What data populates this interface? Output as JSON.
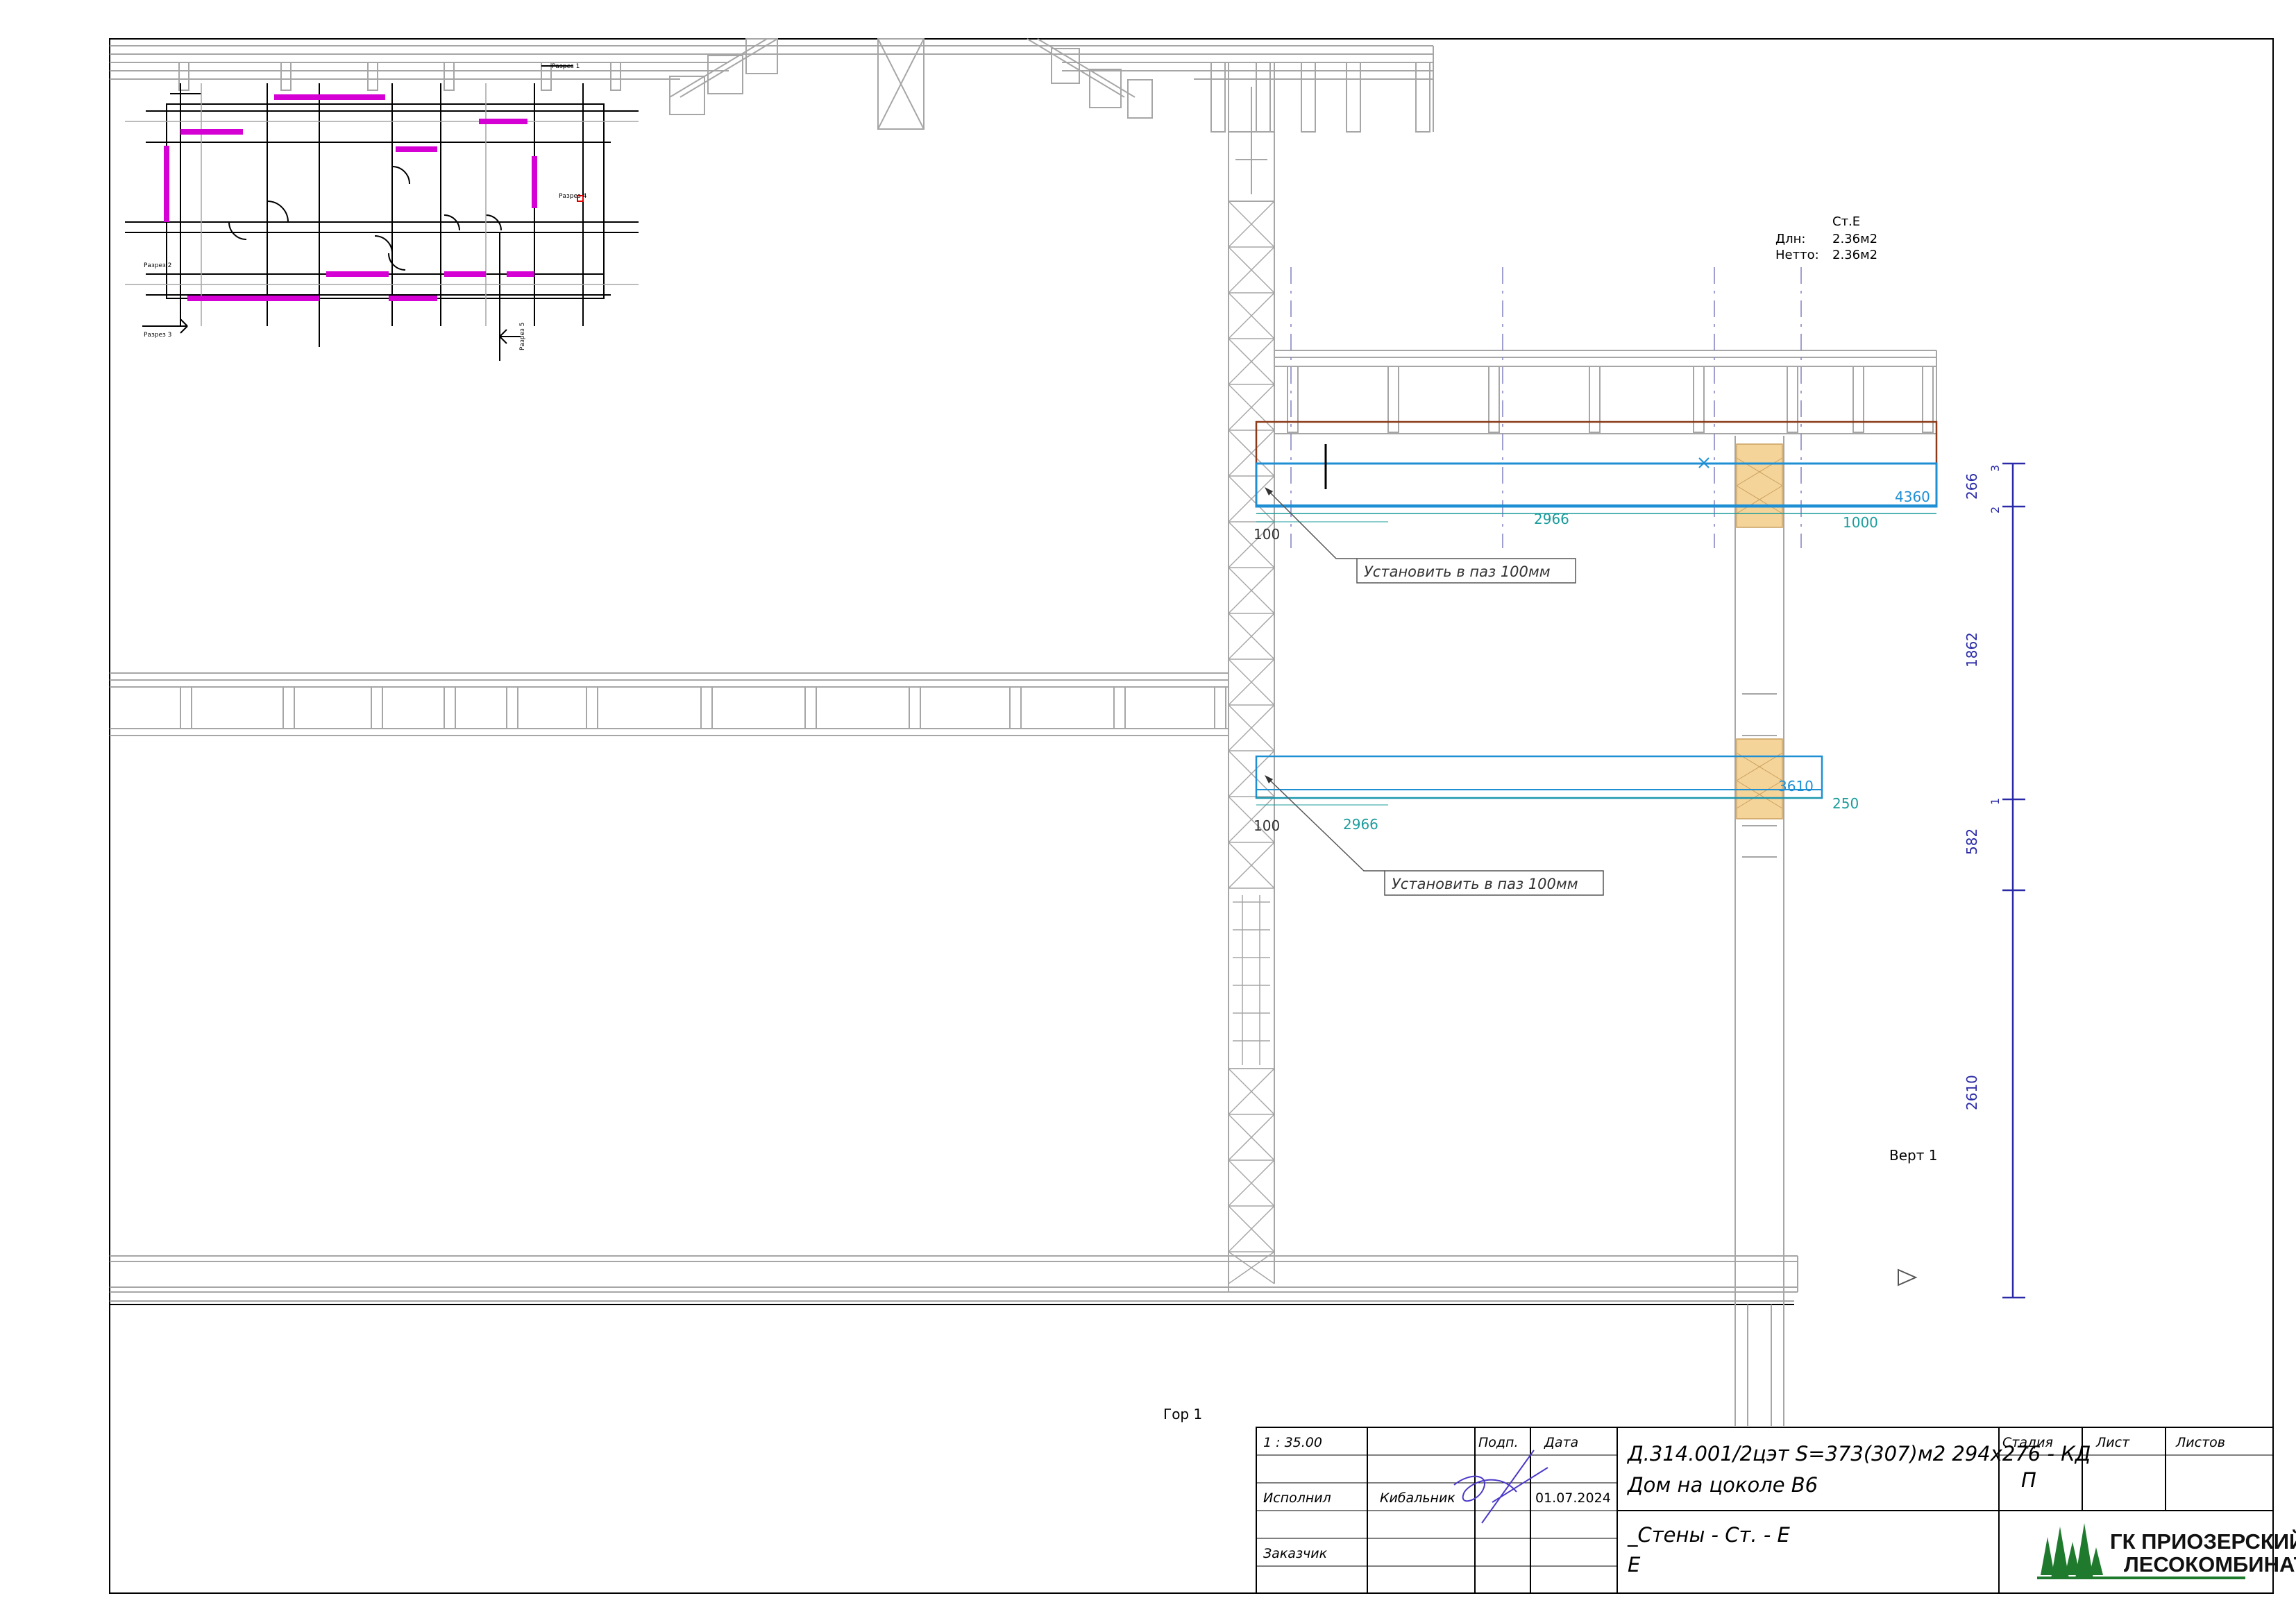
{
  "drawing": {
    "wall_label": "Ст.E",
    "dln_label": "Длн:",
    "dln_value": "2.36м2",
    "netto_label": "Нетто:",
    "netto_value": "2.36м2",
    "vert_label": "Верт 1",
    "hor_label": "Гор 1"
  },
  "beams": [
    {
      "length_label": "4360",
      "segment_label": "2966",
      "overhang_label": "1000",
      "offset_label": "100",
      "note": "Установить в паз 100мм"
    },
    {
      "length_label": "3610",
      "segment_label": "2966",
      "overhang_label": "250",
      "offset_label": "100",
      "note": "Установить в паз 100мм"
    }
  ],
  "vertical_dimensions": {
    "values": [
      "266",
      "1862",
      "582",
      "2610"
    ],
    "level_marks": [
      "3",
      "2",
      "1"
    ]
  },
  "plan": {
    "section_labels": [
      "Разрез 1",
      "Разрез 2",
      "Разрез 3",
      "Разрез 4",
      "Разрез 5"
    ]
  },
  "title_block": {
    "scale": "1 : 35.00",
    "sign_header": "Подп.",
    "date_header": "Дата",
    "role_executor": "Исполнил",
    "executor_name": "Кибальник",
    "date": "01.07.2024",
    "role_customer": "Заказчик",
    "project_code": "Д.314.001/2цэт S=373(307)м2 294х276 - КД",
    "project_name": "Дом на цоколе В6",
    "sheet_title": "_Стены - Ст. - E",
    "sheet_subtitle": "E",
    "stage_header": "Стадия",
    "stage_value": "П",
    "sheet_header": "Лист",
    "sheets_header": "Листов",
    "company_line1": "ГК ПРИОЗЕРСКИЙ",
    "company_line2": "ЛЕСОКОМБИНАТ"
  },
  "colors": {
    "frame": "#000000",
    "grey": "#a6a6a6",
    "beam": "#1f8fd4",
    "dim_teal": "#1a9c9c",
    "dim_navy": "#2a2aa8",
    "magenta": "#d400d4",
    "post": "#f5d49a",
    "roof_red": "#8b3a1a",
    "logo_green": "#1f7a2e"
  }
}
